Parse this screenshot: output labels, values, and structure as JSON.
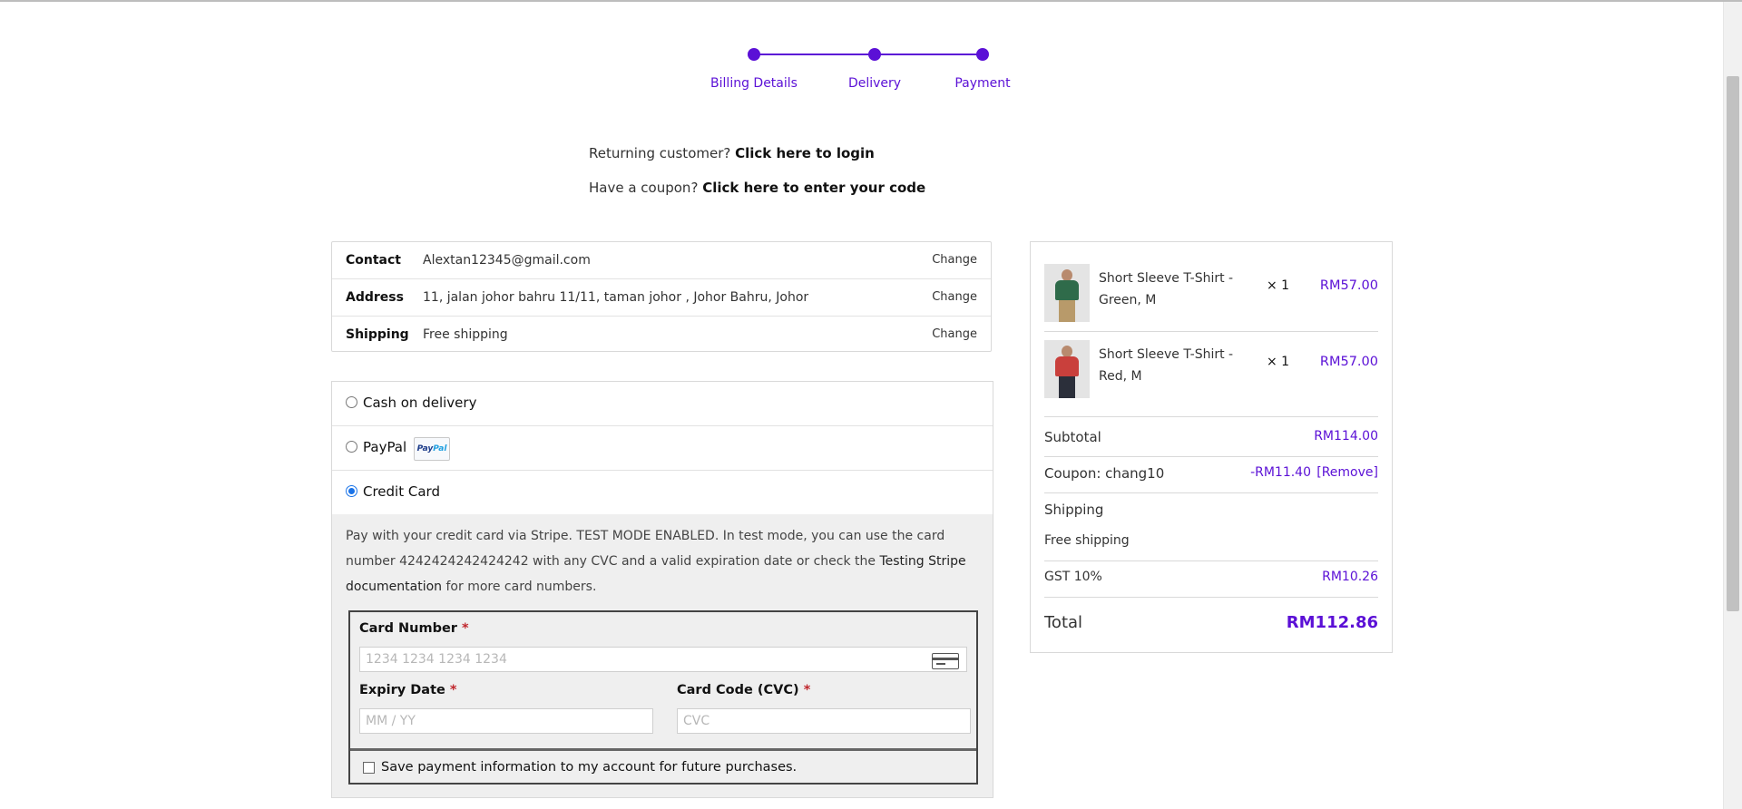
{
  "stepper": {
    "steps": [
      "Billing Details",
      "Delivery",
      "Payment"
    ]
  },
  "notices": {
    "returning_prefix": "Returning customer?",
    "returning_link": "Click here to login",
    "coupon_prefix": "Have a coupon?",
    "coupon_link": "Click here to enter your code"
  },
  "review": {
    "rows": [
      {
        "label": "Contact",
        "value": "Alextan12345@gmail.com",
        "action": "Change"
      },
      {
        "label": "Address",
        "value": "11, jalan johor bahru 11/11, taman johor , Johor Bahru, Johor",
        "action": "Change"
      },
      {
        "label": "Shipping",
        "value": "Free shipping",
        "action": "Change"
      }
    ]
  },
  "payment": {
    "methods": [
      {
        "label": "Cash on delivery",
        "selected": false
      },
      {
        "label": "PayPal",
        "selected": false,
        "badge": "PayPal"
      },
      {
        "label": "Credit Card",
        "selected": true
      }
    ],
    "description_1": "Pay with your credit card via Stripe. TEST MODE ENABLED. In test mode, you can use the card number 4242424242424242 with any CVC and a valid expiration date or check the ",
    "description_link": "Testing Stripe documentation",
    "description_2": " for more card numbers.",
    "card_number_label": "Card Number",
    "card_number_placeholder": "1234 1234 1234 1234",
    "expiry_label": "Expiry Date",
    "expiry_placeholder": "MM / YY",
    "cvc_label": "Card Code (CVC)",
    "cvc_placeholder": "CVC",
    "required_mark": "*",
    "save_label": "Save payment information to my account for future purchases."
  },
  "summary": {
    "items": [
      {
        "name": "Short Sleeve T-Shirt - Green, M",
        "qty": "× 1",
        "price": "RM57.00",
        "shirt_color": "#2f6b4a",
        "legs_color": "#b89a6a"
      },
      {
        "name": "Short Sleeve T-Shirt - Red, M",
        "qty": "× 1",
        "price": "RM57.00",
        "shirt_color": "#c9403c",
        "legs_color": "#2b2f3a"
      }
    ],
    "subtotal_label": "Subtotal",
    "subtotal_value": "RM114.00",
    "coupon_label": "Coupon: chang10",
    "coupon_value": "-RM11.40",
    "coupon_remove": "[Remove]",
    "shipping_label": "Shipping",
    "shipping_value": "Free shipping",
    "tax_label": "GST 10%",
    "tax_value": "RM10.26",
    "total_label": "Total",
    "total_value": "RM112.86"
  },
  "colors": {
    "accent": "#5b10d6",
    "required": "#c0272d"
  }
}
